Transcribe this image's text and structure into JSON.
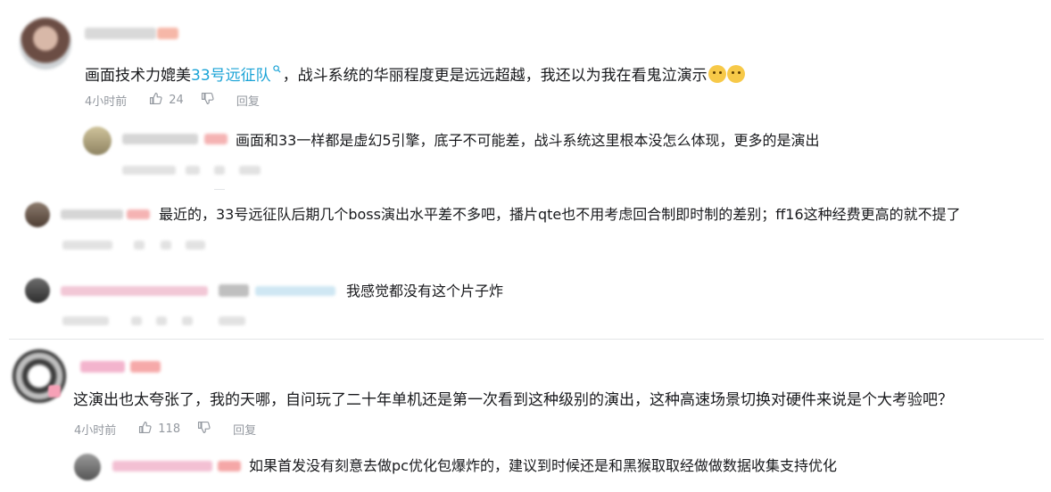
{
  "comments": [
    {
      "text_parts": [
        "画面技术力媲美",
        "33号远征队",
        "，战斗系统的华丽程度更是远远超越，我还以为我在看鬼泣演示"
      ],
      "time": "4小时前",
      "likes": "24",
      "reply_label": "回复",
      "replies": [
        {
          "text": "画面和33一样都是虚幻5引擎，底子不可能差，战斗系统这里根本没怎么体现，更多的是演出"
        }
      ]
    },
    {
      "text": "最近的，33号远征队后期几个boss演出水平差不多吧，播片qte也不用考虑回合制即时制的差别；ff16这种经费更高的就不提了"
    },
    {
      "text": "我感觉都没有这个片子炸"
    },
    {
      "text": "这演出也太夸张了，我的天哪，自问玩了二十年单机还是第一次看到这种级别的演出，这种高速场景切换对硬件来说是个大考验吧？",
      "time": "4小时前",
      "likes": "118",
      "replies": [
        {
          "text": "如果首发没有刻意去做pc优化包爆炸的，建议到时候还是和黑猴取取经做做数据收集支持优化"
        }
      ]
    }
  ],
  "icons": [
    "thumbs-up-icon",
    "thumbs-down-icon",
    "search-icon",
    "emoji-icon"
  ],
  "colors": {
    "link": "#1aa3d6",
    "meta": "#9499a0",
    "text": "#18191c"
  }
}
